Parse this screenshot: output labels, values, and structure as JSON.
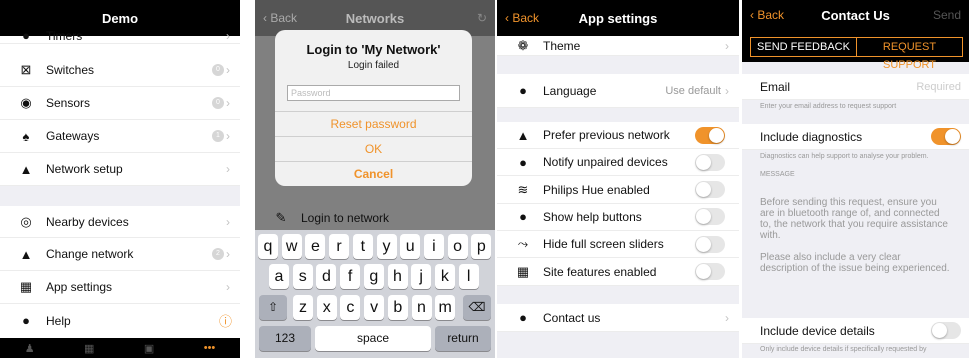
{
  "screen1": {
    "title": "Demo",
    "rows": [
      {
        "icon": "timer-icon",
        "label": "Timers",
        "badge": ""
      },
      {
        "icon": "switch-icon",
        "label": "Switches",
        "badge": "0"
      },
      {
        "icon": "sensor-icon",
        "label": "Sensors",
        "badge": "0"
      },
      {
        "icon": "gateway-icon",
        "label": "Gateways",
        "badge": "1"
      },
      {
        "icon": "network-setup-icon",
        "label": "Network setup",
        "badge": ""
      },
      {
        "icon": "nearby-devices-icon",
        "label": "Nearby devices",
        "badge": ""
      },
      {
        "icon": "change-network-icon",
        "label": "Change network",
        "badge": "2"
      },
      {
        "icon": "app-settings-icon",
        "label": "App settings",
        "badge": ""
      },
      {
        "icon": "help-icon",
        "label": "Help",
        "badge": ""
      }
    ],
    "tabs": [
      "lamp-icon",
      "grid-icon",
      "image-icon",
      "more-icon"
    ]
  },
  "screen2": {
    "back": "Back",
    "title": "Networks",
    "alert_title": "Login to 'My Network'",
    "alert_message": "Login failed",
    "password_placeholder": "Password",
    "reset_label": "Reset password",
    "ok_label": "OK",
    "cancel_label": "Cancel",
    "list_item": "Login to network",
    "keyboard_row1": [
      "q",
      "w",
      "e",
      "r",
      "t",
      "y",
      "u",
      "i",
      "o",
      "p"
    ],
    "keyboard_row2": [
      "a",
      "s",
      "d",
      "f",
      "g",
      "h",
      "j",
      "k",
      "l"
    ],
    "keyboard_row3": [
      "z",
      "x",
      "c",
      "v",
      "b",
      "n",
      "m"
    ],
    "key_123": "123",
    "key_space": "space",
    "key_return": "return"
  },
  "screen3": {
    "back": "Back",
    "title": "App settings",
    "theme_label": "Theme",
    "language_label": "Language",
    "language_value": "Use default",
    "settings": [
      {
        "label": "Prefer previous network",
        "on": true
      },
      {
        "label": "Notify unpaired devices",
        "on": false
      },
      {
        "label": "Philips Hue enabled",
        "on": false
      },
      {
        "label": "Show help buttons",
        "on": false
      },
      {
        "label": "Hide full screen sliders",
        "on": false
      },
      {
        "label": "Site features enabled",
        "on": false
      }
    ],
    "contact_label": "Contact us"
  },
  "screen4": {
    "back": "Back",
    "title": "Contact Us",
    "send": "Send",
    "seg_feedback": "SEND FEEDBACK",
    "seg_support": "REQUEST SUPPORT",
    "email_label": "Email",
    "email_placeholder": "Required",
    "email_hint": "Enter your email address to request support",
    "diag_label": "Include diagnostics",
    "diag_hint": "Diagnostics can help support to analyse your problem.",
    "message_header": "MESSAGE",
    "message_p1": "Before sending this request, ensure you are in bluetooth range of, and connected to, the network that you require assistance with.",
    "message_p2": "Please also include a very clear description of the issue being experienced.",
    "device_label": "Include device details",
    "device_hint": "Only include device details if specifically requested by"
  }
}
